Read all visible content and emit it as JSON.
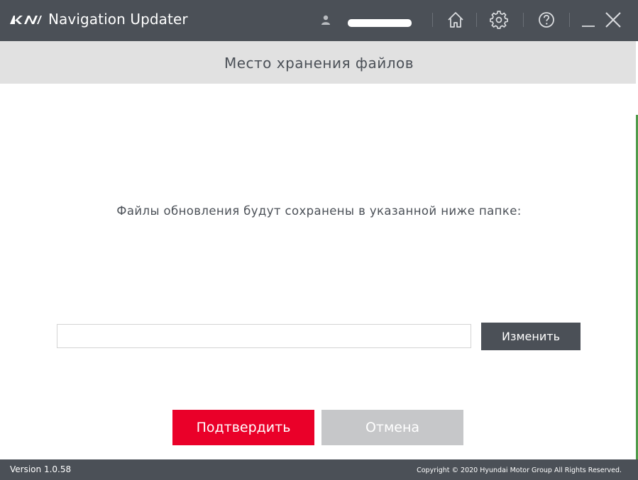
{
  "titlebar": {
    "brand": "KIA",
    "app_title": "Navigation Updater",
    "icons": {
      "user": "user-icon",
      "home": "home-icon",
      "settings": "gear-icon",
      "help": "help-icon",
      "minimize": "minimize-icon",
      "close": "close-icon"
    }
  },
  "subheader": {
    "title": "Место хранения файлов"
  },
  "main": {
    "message": "Файлы обновления будут сохранены в указанной ниже папке:",
    "path_value": "",
    "change_label": "Изменить"
  },
  "actions": {
    "confirm_label": "Подтвердить",
    "cancel_label": "Отмена"
  },
  "footer": {
    "version": "Version 1.0.58",
    "copyright": "Copyright © 2020 Hyundai Motor Group All Rights Reserved."
  },
  "colors": {
    "titlebar": "#4b5057",
    "subheader": "#e1e1e1",
    "accent_red": "#ea0029",
    "disabled_gray": "#c6c7c9",
    "text_dark": "#4b5057"
  }
}
